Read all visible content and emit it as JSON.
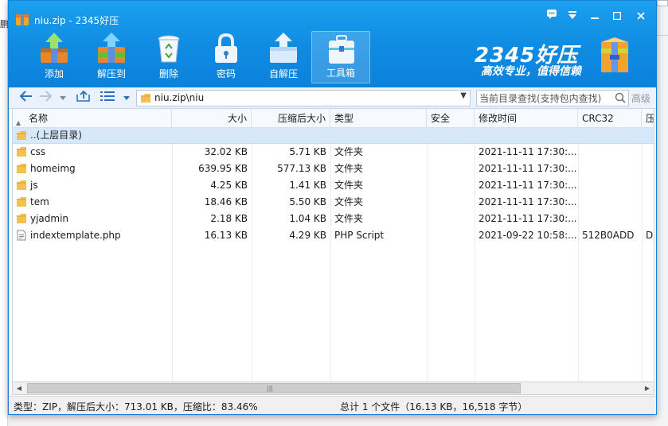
{
  "window": {
    "title": "niu.zip - 2345好压"
  },
  "toolbar": {
    "add": "添加",
    "extract_to": "解压到",
    "delete": "删除",
    "password": "密码",
    "self_extract": "自解压",
    "toolbox": "工具箱"
  },
  "brand": {
    "name": "2345好压",
    "slogan": "高效专业，值得信赖"
  },
  "address": {
    "path": "niu.zip\\niu",
    "search_placeholder": "当前目录查找(支持包内查找)",
    "advanced": "高级"
  },
  "columns": {
    "name": "名称",
    "size": "大小",
    "packed": "压缩后大小",
    "type": "类型",
    "security": "安全",
    "modified": "修改时间",
    "crc": "CRC32",
    "extra": "压"
  },
  "parent_row": {
    "name": "..(上层目录)"
  },
  "files": [
    {
      "name": "css",
      "size": "32.02 KB",
      "packed": "5.71 KB",
      "type": "文件夹",
      "modified": "2021-11-11 17:30:...",
      "crc": "",
      "extra": "",
      "kind": "folder"
    },
    {
      "name": "homeimg",
      "size": "639.95 KB",
      "packed": "577.13 KB",
      "type": "文件夹",
      "modified": "2021-11-11 17:30:...",
      "crc": "",
      "extra": "",
      "kind": "folder"
    },
    {
      "name": "js",
      "size": "4.25 KB",
      "packed": "1.41 KB",
      "type": "文件夹",
      "modified": "2021-11-11 17:30:...",
      "crc": "",
      "extra": "",
      "kind": "folder"
    },
    {
      "name": "tem",
      "size": "18.46 KB",
      "packed": "5.50 KB",
      "type": "文件夹",
      "modified": "2021-11-11 17:30:...",
      "crc": "",
      "extra": "",
      "kind": "folder"
    },
    {
      "name": "yjadmin",
      "size": "2.18 KB",
      "packed": "1.04 KB",
      "type": "文件夹",
      "modified": "2021-11-11 17:30:...",
      "crc": "",
      "extra": "",
      "kind": "folder"
    },
    {
      "name": "indextemplate.php",
      "size": "16.13 KB",
      "packed": "4.29 KB",
      "type": "PHP Script",
      "modified": "2021-09-22 10:58:...",
      "crc": "512B0ADD",
      "extra": "De",
      "kind": "file"
    }
  ],
  "status": {
    "left": "类型：ZIP，解压后大小：713.01 KB，压缩比：83.46%",
    "right": "总计 1 个文件（16.13 KB，16,518 字节）"
  },
  "background": {
    "left_char": "鹏"
  },
  "colors": {
    "title_blue": "#0f8be2",
    "selected_row": "#d7e8fa",
    "folder_yellow": "#f2c14e"
  }
}
